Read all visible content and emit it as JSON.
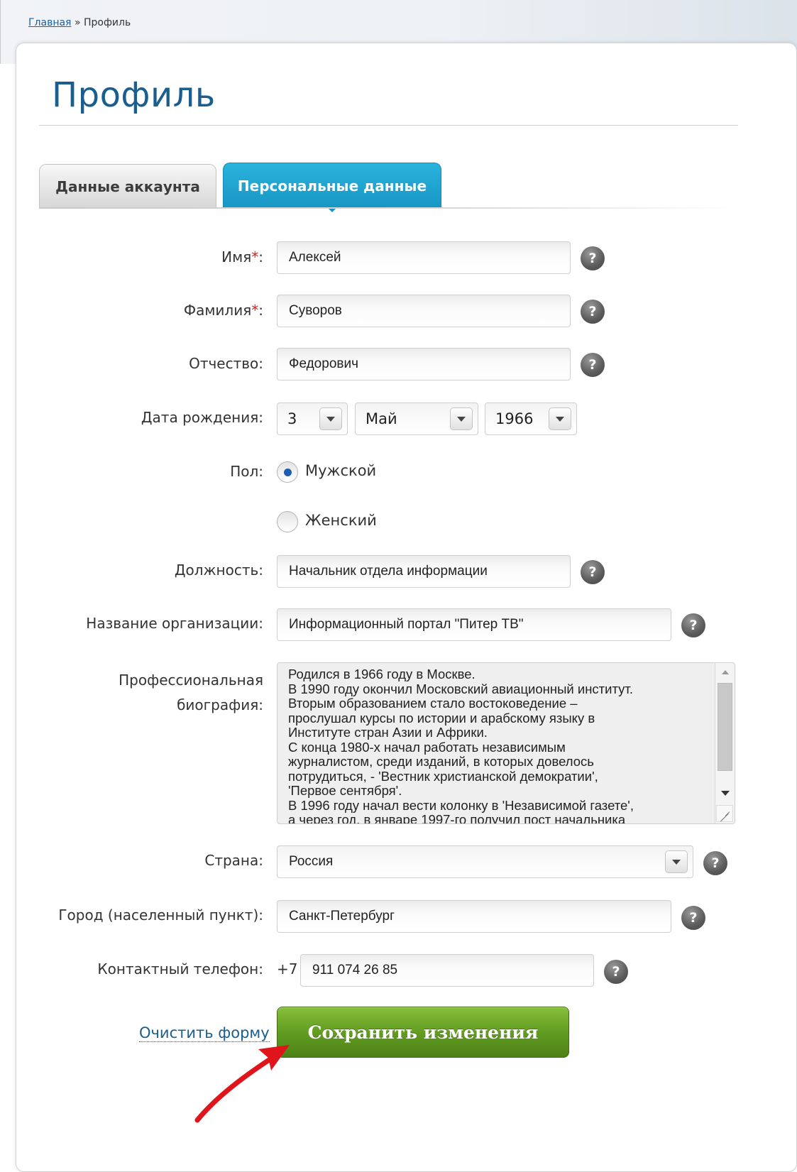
{
  "breadcrumb": {
    "home": "Главная",
    "separator": "»",
    "current": "Профиль"
  },
  "page": {
    "title": "Профиль"
  },
  "tabs": [
    {
      "label": "Данные аккаунта",
      "active": false
    },
    {
      "label": "Персональные данные",
      "active": true
    }
  ],
  "form": {
    "first_name": {
      "label": "Имя",
      "required_mark": "*",
      "suffix": ":",
      "value": "Алексей"
    },
    "last_name": {
      "label": "Фамилия",
      "required_mark": "*",
      "suffix": ":",
      "value": "Суворов"
    },
    "patronymic": {
      "label": "Отчество:",
      "value": "Федорович"
    },
    "birth_date": {
      "label": "Дата рождения:",
      "day": "3",
      "month": "Май",
      "year": "1966"
    },
    "gender": {
      "label": "Пол:",
      "options": [
        "Мужской",
        "Женский"
      ],
      "selected": "Мужской"
    },
    "position": {
      "label": "Должность:",
      "value": "Начальник отдела информации"
    },
    "organization": {
      "label": "Название организации:",
      "value": "Информационный портал \"Питер ТВ\""
    },
    "biography": {
      "label_line1": "Профессиональная",
      "label_line2": "биография:",
      "value": "Родился в 1966 году в Москве.\nВ 1990 году окончил Московский авиационный институт.\nВторым образованием стало востоковедение –\nпрослушал курсы по истории и арабскому языку в\nИнституте стран Азии и Африки.\nС конца 1980-х начал работать независимым\nжурналистом, среди изданий, в которых довелось\nпотрудиться, - 'Вестник христианской демократии',\n'Первое сентября'.\nВ 1996 году начал вести колонку в 'Независимой газете',\nа через год, в январе 1997-го получил пост начальника"
    },
    "country": {
      "label": "Страна:",
      "value": "Россия"
    },
    "city": {
      "label": "Город (населенный пункт):",
      "value": "Санкт-Петербург"
    },
    "phone": {
      "label": "Контактный телефон:",
      "prefix": "+7",
      "value": "911 074 26 85"
    },
    "help_glyph": "?"
  },
  "actions": {
    "clear_label": "Очистить форму",
    "save_label": "Сохранить изменения"
  },
  "colors": {
    "accent_blue": "#1796c4",
    "title_blue": "#1a5d8f",
    "save_green": "#5f9a20",
    "annotation_red": "#e0151b"
  },
  "icons": {
    "help": "question-circle-icon",
    "dropdown": "chevron-down-icon",
    "annotation": "red-arrow-annotation"
  }
}
